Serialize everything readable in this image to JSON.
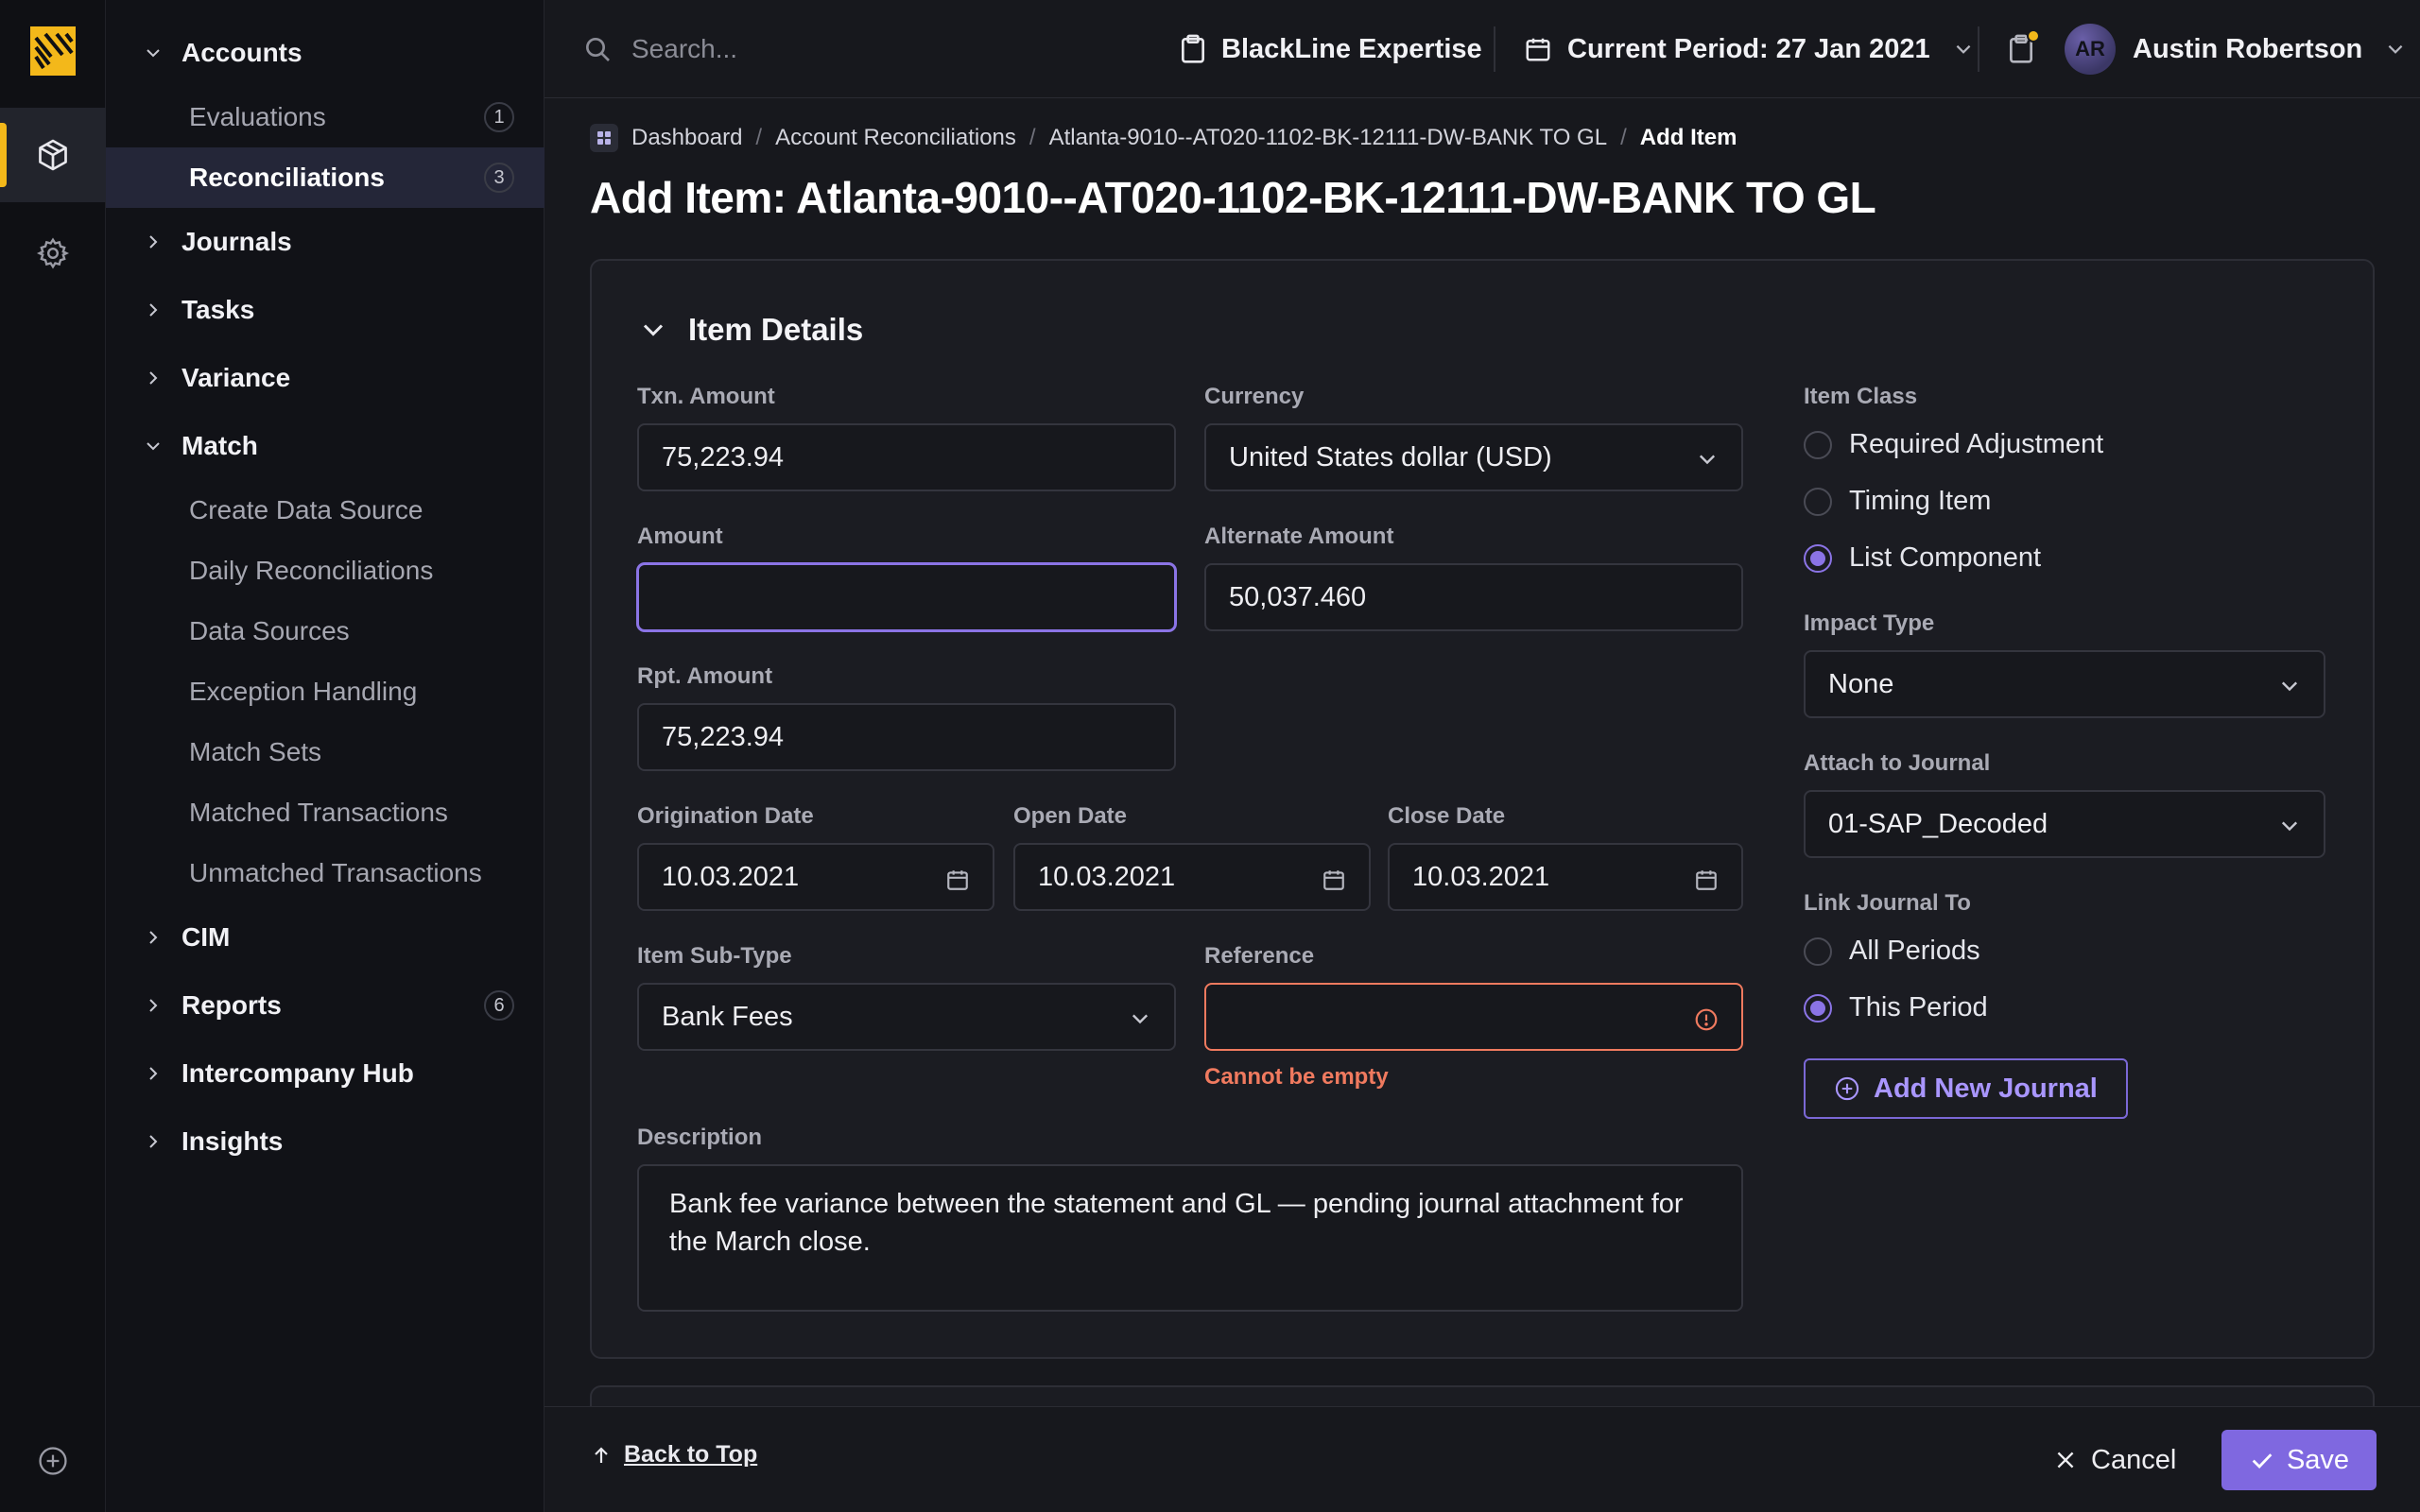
{
  "rail": {
    "logo": "blackline-logo",
    "items": [
      {
        "icon": "cube-icon",
        "active": true
      },
      {
        "icon": "gear-icon",
        "active": false
      }
    ],
    "bottom_icon": "plus-circle-icon"
  },
  "nav": {
    "accounts": {
      "label": "Accounts",
      "expanded": true
    },
    "evaluations": {
      "label": "Evaluations",
      "badge": "1"
    },
    "reconciliations": {
      "label": "Reconciliations",
      "badge": "3",
      "selected": true
    },
    "journals": {
      "label": "Journals"
    },
    "tasks": {
      "label": "Tasks"
    },
    "variance": {
      "label": "Variance"
    },
    "match": {
      "label": "Match",
      "expanded": true
    },
    "match_items": [
      "Create Data Source",
      "Daily Reconciliations",
      "Data Sources",
      "Exception Handling",
      "Match Sets",
      "Matched Transactions",
      "Unmatched Transactions"
    ],
    "cim": {
      "label": "CIM"
    },
    "reports": {
      "label": "Reports",
      "badge": "6"
    },
    "intercompany": {
      "label": "Intercompany Hub"
    },
    "insights": {
      "label": "Insights"
    }
  },
  "topbar": {
    "search_placeholder": "Search...",
    "expertise": "BlackLine Expertise",
    "period": "Current Period: 27 Jan 2021",
    "user_initials": "AR",
    "user_name": "Austin Robertson"
  },
  "breadcrumb": [
    "Dashboard",
    "Account Reconciliations",
    "Atlanta-9010--AT020-1102-BK-12111-DW-BANK TO GL",
    "Add Item"
  ],
  "page_title": "Add Item: Atlanta-9010--AT020-1102-BK-12111-DW-BANK TO GL",
  "section": {
    "title": "Item Details",
    "txn_amount": {
      "label": "Txn. Amount",
      "value": "75,223.94"
    },
    "currency": {
      "label": "Currency",
      "value": "United States dollar (USD)"
    },
    "amount": {
      "label": "Amount",
      "value": ""
    },
    "alt_amount": {
      "label": "Alternate Amount",
      "value": "50,037.460"
    },
    "rpt_amount": {
      "label": "Rpt. Amount",
      "value": "75,223.94"
    },
    "origination_date": {
      "label": "Origination Date",
      "value": "10.03.2021"
    },
    "open_date": {
      "label": "Open Date",
      "value": "10.03.2021"
    },
    "close_date": {
      "label": "Close Date",
      "value": "10.03.2021"
    },
    "sub_type": {
      "label": "Item Sub-Type",
      "value": "Bank Fees"
    },
    "reference": {
      "label": "Reference",
      "value": "",
      "error": "Cannot be empty"
    },
    "description": {
      "label": "Description",
      "value": "Bank fee variance between the statement and GL — pending journal attachment for the March close."
    },
    "item_class": {
      "label": "Item Class",
      "options": [
        "Required Adjustment",
        "Timing Item",
        "List Component"
      ],
      "selected": "List Component"
    },
    "impact_type": {
      "label": "Impact Type",
      "value": "None"
    },
    "attach_journal": {
      "label": "Attach to Journal",
      "value": "01-SAP_Decoded"
    },
    "link_journal": {
      "label": "Link Journal To",
      "options": [
        "All Periods",
        "This Period"
      ],
      "selected": "This Period"
    },
    "add_journal_label": "Add New Journal"
  },
  "footer": {
    "back_to_top": "Back to Top",
    "cancel": "Cancel",
    "save": "Save"
  },
  "colors": {
    "accent": "#7f68e0",
    "brand": "#f3b81a",
    "error": "#f07a5f"
  }
}
